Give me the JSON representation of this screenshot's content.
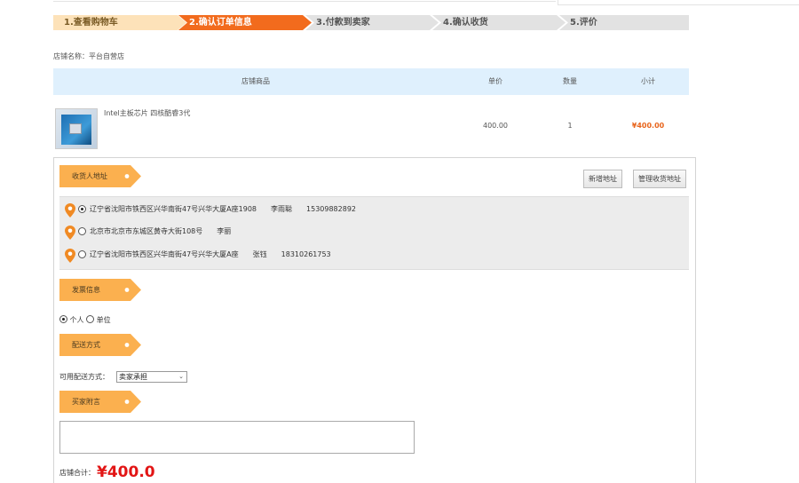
{
  "steps": [
    {
      "label": "1.查看购物车",
      "state": "done"
    },
    {
      "label": "2.确认订单信息",
      "state": "active"
    },
    {
      "label": "3.付款到卖家",
      "state": "todo"
    },
    {
      "label": "4.确认收货",
      "state": "todo"
    },
    {
      "label": "5.评价",
      "state": "todo"
    }
  ],
  "store": {
    "label": "店铺名称：平台自营店"
  },
  "table": {
    "headers": {
      "goods": "店铺商品",
      "price": "单价",
      "qty": "数量",
      "subtotal": "小计"
    },
    "items": [
      {
        "name": "Intel主板芯片 四核酷睿3代",
        "price": "400.00",
        "qty": "1",
        "subtotal": "¥400.00"
      }
    ]
  },
  "address": {
    "title": "收货人地址",
    "add_button": "新增地址",
    "manage_button": "管理收货地址",
    "list": [
      {
        "text": "辽宁省沈阳市铁西区兴华南街47号兴华大厦A座1908　　李雨聪　　15309882892",
        "selected": true
      },
      {
        "text": "北京市北京市东城区黄寺大街108号　　李丽",
        "selected": false
      },
      {
        "text": "辽宁省沈阳市铁西区兴华南街47号兴华大厦A座　　张钰　　18310261753",
        "selected": false
      }
    ]
  },
  "invoice": {
    "title": "发票信息",
    "options": [
      {
        "label": "个人",
        "selected": true
      },
      {
        "label": "单位",
        "selected": false
      }
    ]
  },
  "shipping": {
    "title": "配送方式",
    "label": "可用配送方式：",
    "selected": "卖家承担"
  },
  "memo": {
    "title": "买家附言"
  },
  "total": {
    "label": "店铺合计：",
    "amount": "¥400.0"
  },
  "colors": {
    "accent": "#f26b1d",
    "tag_orange": "#fbb04f",
    "header_blue": "#dff0fd",
    "price_red": "#e21515"
  }
}
